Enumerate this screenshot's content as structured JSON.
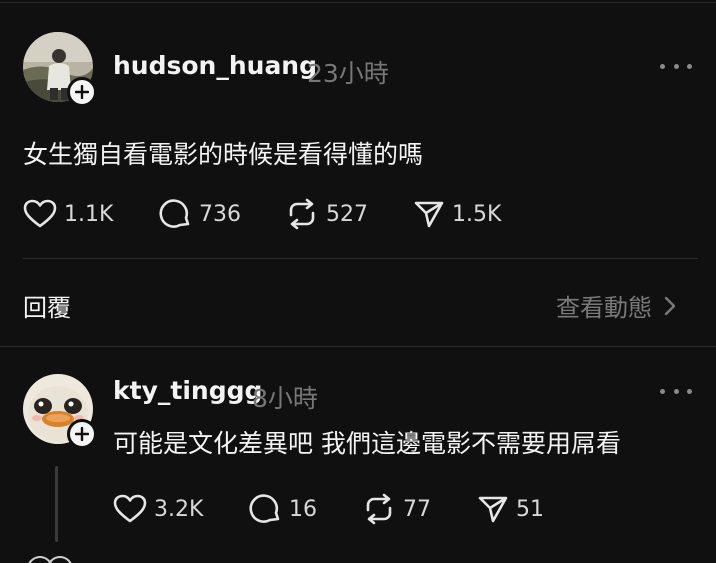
{
  "post": {
    "username": "hudson_huang",
    "time": "23小時",
    "text": "女生獨自看電影的時候是看得懂的嗎",
    "likes": "1.1K",
    "replies": "736",
    "reposts": "527",
    "shares": "1.5K"
  },
  "replies_bar": {
    "label": "回覆",
    "view_activity": "查看動態"
  },
  "reply": {
    "username": "kty_tinggg",
    "time": "8小時",
    "text": "可能是文化差異吧 我們這邊電影不需要用屌看",
    "likes": "3.2K",
    "replies": "16",
    "reposts": "77",
    "shares": "51"
  },
  "colors": {
    "background": "#101010",
    "text": "#f3f3f3",
    "muted": "#777777"
  }
}
